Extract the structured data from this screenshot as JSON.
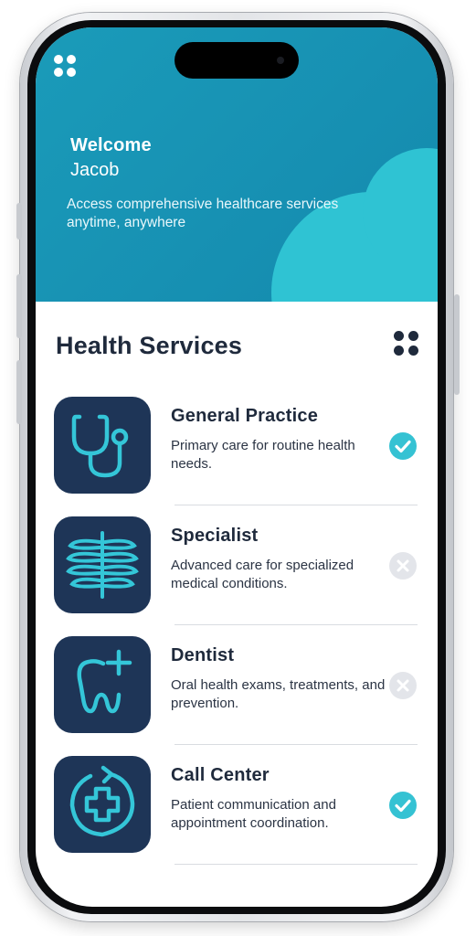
{
  "hero": {
    "welcome": "Welcome",
    "user_name": "Jacob",
    "tagline": "Access comprehensive healthcare services anytime, anywhere"
  },
  "section": {
    "title": "Health Services"
  },
  "services": [
    {
      "name": "General Practice",
      "description": "Primary care for routine health needs.",
      "icon": "stethoscope-icon",
      "enabled": true
    },
    {
      "name": "Specialist",
      "description": "Advanced care for specialized medical conditions.",
      "icon": "ribcage-icon",
      "enabled": false
    },
    {
      "name": "Dentist",
      "description": "Oral health exams, treatments, and prevention.",
      "icon": "tooth-icon",
      "enabled": false
    },
    {
      "name": "Call Center",
      "description": "Patient communication and appointment coordination.",
      "icon": "medical-cross-refresh-icon",
      "enabled": true
    }
  ],
  "colors": {
    "hero_bg": "#1791b3",
    "hero_cloud": "#2fc3d3",
    "tile_bg": "#1e3557",
    "icon_stroke": "#34c6d8",
    "check_on": "#35c2d3",
    "check_off": "#e3e5ea",
    "text_dark": "#1f2a3c"
  }
}
